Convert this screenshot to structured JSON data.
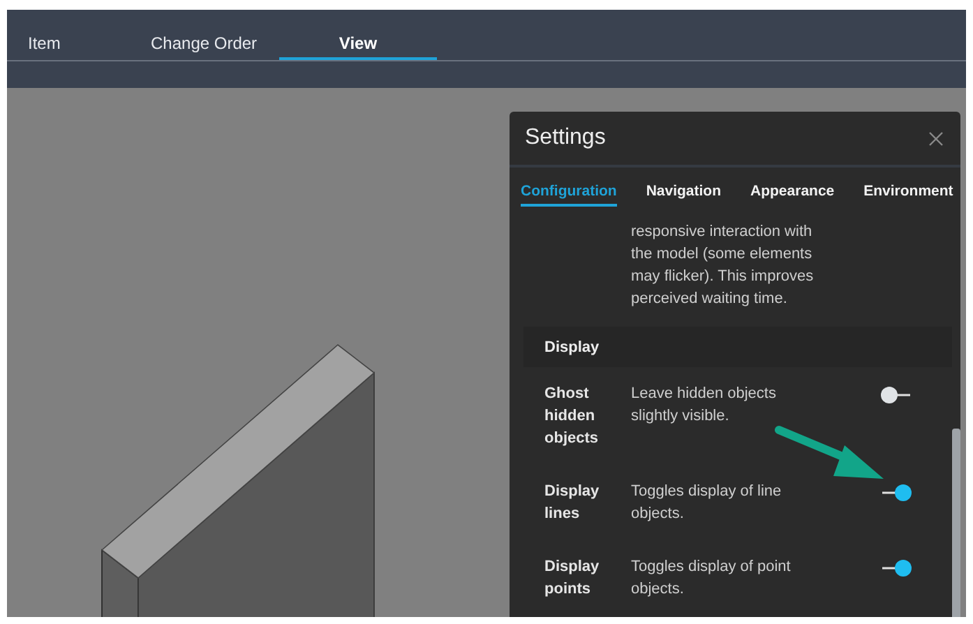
{
  "top_tabs": [
    {
      "label": "Item",
      "selected": false
    },
    {
      "label": "Change Order",
      "selected": false
    },
    {
      "label": "View",
      "selected": true
    }
  ],
  "settings": {
    "title": "Settings",
    "tabs": [
      {
        "label": "Configuration",
        "selected": true
      },
      {
        "label": "Navigation",
        "selected": false
      },
      {
        "label": "Appearance",
        "selected": false
      },
      {
        "label": "Environment",
        "selected": false
      }
    ],
    "intro_text": "responsive interaction with the model (some elements may flicker). This improves perceived waiting time.",
    "section_title": "Display",
    "options": [
      {
        "label": "Ghost hidden objects",
        "description": "Leave hidden objects slightly visible.",
        "on": false
      },
      {
        "label": "Display lines",
        "description": "Toggles display of line objects.",
        "on": true
      },
      {
        "label": "Display points",
        "description": "Toggles display of point objects.",
        "on": true
      }
    ]
  }
}
